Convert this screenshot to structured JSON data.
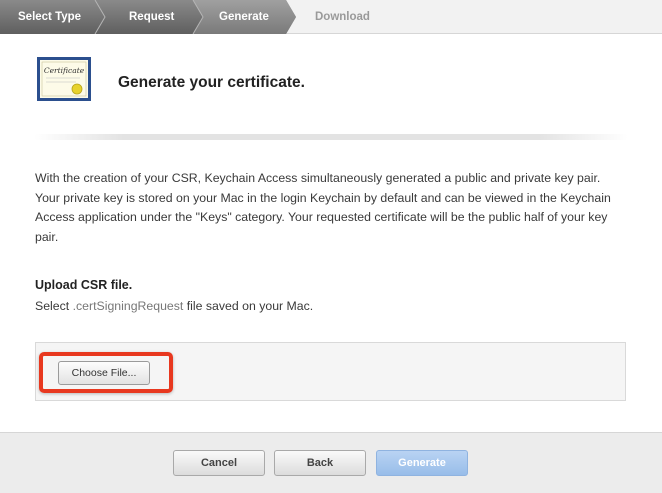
{
  "steps": [
    {
      "label": "Select Type",
      "state": "done"
    },
    {
      "label": "Request",
      "state": "done"
    },
    {
      "label": "Generate",
      "state": "current"
    },
    {
      "label": "Download",
      "state": "upcoming"
    }
  ],
  "header": {
    "title": "Generate your certificate.",
    "icon": "certificate-icon",
    "icon_text": "Certificate"
  },
  "description": "With the creation of your CSR, Keychain Access simultaneously generated a public and private key pair. Your private key is stored on your Mac in the login Keychain by default and can be viewed in the Keychain Access application under the \"Keys\" category. Your requested certificate will be the public half of your key pair.",
  "upload": {
    "title": "Upload CSR file.",
    "sub_prefix": "Select ",
    "sub_ext": ".certSigningRequest",
    "sub_suffix": " file saved on your Mac.",
    "choose_label": "Choose File..."
  },
  "footer": {
    "cancel_label": "Cancel",
    "back_label": "Back",
    "generate_label": "Generate"
  },
  "colors": {
    "step_done": "#6f6f6f",
    "step_current": "#8a8a8a",
    "highlight": "#e8381f",
    "primary_button": "#98bde9"
  }
}
